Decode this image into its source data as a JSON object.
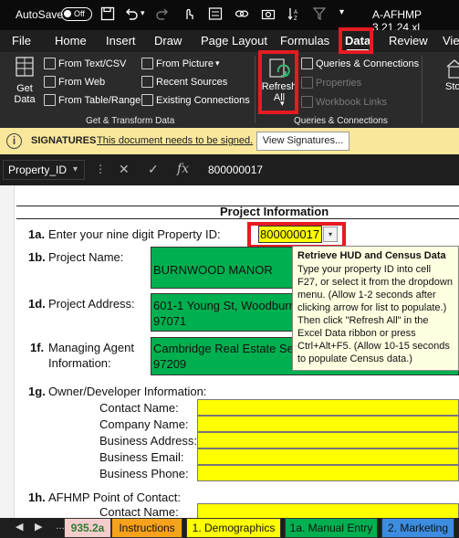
{
  "titlebar": {
    "autosave_label": "AutoSave",
    "toggle_state": "Off",
    "filename": "A-AFHMP 3.21.24.xl"
  },
  "tabs": [
    "File",
    "Home",
    "Insert",
    "Draw",
    "Page Layout",
    "Formulas",
    "Data",
    "Review",
    "View"
  ],
  "active_tab": "Data",
  "ribbon": {
    "get_data": [
      "Get",
      "Data"
    ],
    "from_text_csv": "From Text/CSV",
    "from_web": "From Web",
    "from_table_range": "From Table/Range",
    "from_picture": "From Picture",
    "recent_sources": "Recent Sources",
    "existing_connections": "Existing Connections",
    "group_get_transform": "Get & Transform Data",
    "refresh_all": [
      "Refresh",
      "All"
    ],
    "queries_connections": "Queries & Connections",
    "properties": "Properties",
    "workbook_links": "Workbook Links",
    "group_queries": "Queries & Connections",
    "stocks_partial": "Sto"
  },
  "signature_bar": {
    "title": "SIGNATURES",
    "message": "This document needs to be signed.",
    "button": "View Signatures..."
  },
  "formula_bar": {
    "name_box": "Property_ID",
    "value": "800000017"
  },
  "sheet": {
    "section_title": "Project Information",
    "r1a_num": "1a.",
    "r1a_label": "Enter your nine digit Property ID:",
    "property_id": "800000017",
    "r1b_num": "1b.",
    "r1b_label": "Project Name:",
    "project_name": "BURNWOOD MANOR",
    "r1d_num": "1d.",
    "r1d_label": "Project Address:",
    "address_line1": "601-1 Young St, Woodburn",
    "address_line2": "97071",
    "r1f_num": "1f.",
    "r1f_label_line1": "Managing Agent",
    "r1f_label_line2": "Information:",
    "agent_line1": "Cambridge Real Estate Serv",
    "agent_line2": "97209",
    "r1g_num": "1g.",
    "r1g_label": "Owner/Developer Information:",
    "contact_fields": [
      "Contact Name:",
      "Company Name:",
      "Business Address:",
      "Business Email:",
      "Business Phone:"
    ],
    "r1h_num": "1h.",
    "r1h_label": "AFHMP Point of Contact:",
    "r1h_contact": "Contact Name:"
  },
  "tooltip": {
    "title": "Retrieve HUD and Census Data",
    "body": "Type your property ID into cell F27, or select it from the dropdown menu. (Allow 1-2 seconds after clicking arrow for list to populate.) Then click \"Refresh All\" in the Excel Data ribbon or press Ctrl+Alt+F5. (Allow 10-15 seconds to populate Census data.)"
  },
  "sheet_tabs": [
    {
      "label": "935.2a",
      "color": "#f4cccc"
    },
    {
      "label": "Instructions",
      "color": "#f7a21b"
    },
    {
      "label": "1. Demographics",
      "color": "#ffff00"
    },
    {
      "label": "1a. Manual Entry",
      "color": "#00b050"
    },
    {
      "label": "2. Marketing",
      "color": "#3c8de0"
    }
  ]
}
